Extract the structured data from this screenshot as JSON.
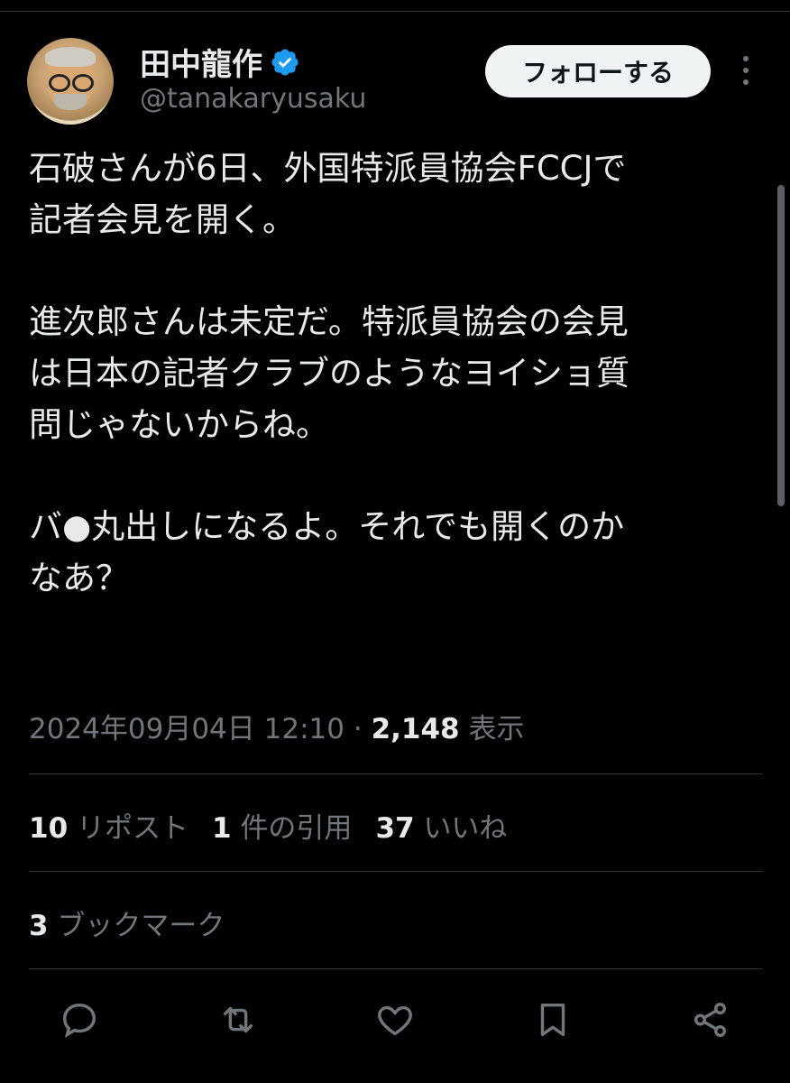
{
  "profile": {
    "name": "田中龍作",
    "handle": "@tanakaryusaku",
    "verified_color": "#1d9bf0"
  },
  "header": {
    "follow_label": "フォローする",
    "more_icon": "more-vertical-icon"
  },
  "tweet": {
    "paragraphs": [
      "石破さんが6日、外国特派員協会FCCJで\n記者会見を開く。",
      "進次郎さんは未定だ。特派員協会の会見\nは日本の記者クラブのようなヨイショ質\n問じゃないからね。",
      "バ●丸出しになるよ。それでも開くのか\nなあ？"
    ]
  },
  "meta": {
    "timestamp": "2024年09月04日 12:10",
    "separator": "·",
    "views_count": "2,148",
    "views_label": "表示"
  },
  "stats": {
    "reposts_count": "10",
    "reposts_label": "リポスト",
    "quotes_count": "1",
    "quotes_label": "件の引用",
    "likes_count": "37",
    "likes_label": "いいね"
  },
  "bookmarks": {
    "count": "3",
    "label": "ブックマーク"
  },
  "actions": [
    "reply-icon",
    "retweet-icon",
    "like-icon",
    "bookmark-icon",
    "share-icon"
  ],
  "colors": {
    "background": "#000000",
    "text": "#e7e9ea",
    "muted": "#71767b",
    "divider": "#2f3336"
  }
}
